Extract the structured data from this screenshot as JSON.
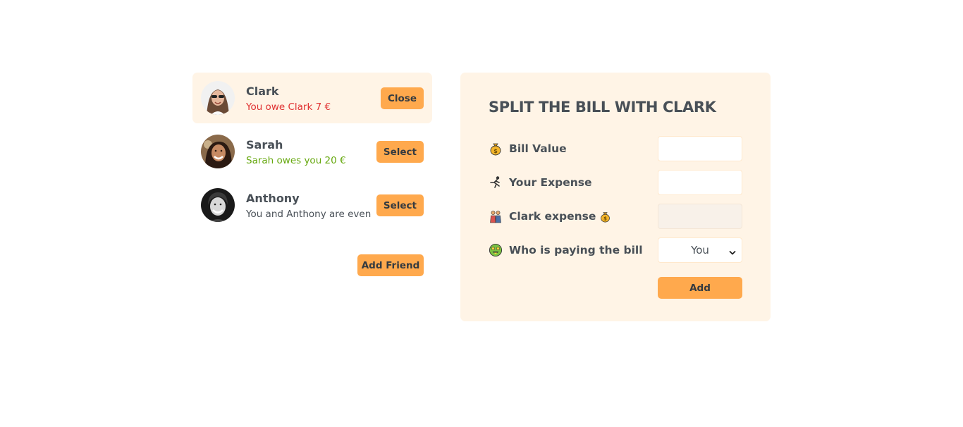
{
  "friends": [
    {
      "name": "Clark",
      "status": "You owe Clark 7 €",
      "status_tone": "red",
      "button": "Close",
      "selected": true
    },
    {
      "name": "Sarah",
      "status": "Sarah owes you 20 €",
      "status_tone": "green",
      "button": "Select",
      "selected": false
    },
    {
      "name": "Anthony",
      "status": "You and Anthony are even",
      "status_tone": "neutral",
      "button": "Select",
      "selected": false
    }
  ],
  "add_friend_label": "Add Friend",
  "split": {
    "title": "Split the bill with Clark",
    "bill_value_label": "Bill Value",
    "your_expense_label": "Your Expense",
    "friend_expense_label": "Clark expense",
    "payer_label": "Who is paying the bill",
    "bill_value": "",
    "your_expense": "",
    "friend_expense": "",
    "payer_selected": "You",
    "add_label": "Add"
  },
  "icons": {
    "bill_value": "money-bag-icon",
    "your_expense": "person-running-icon",
    "friend_expense": "couple-icon",
    "friend_expense_suffix": "money-bag-icon",
    "payer": "money-mouth-face-icon"
  },
  "colors": {
    "accent": "#ffa94d",
    "panel_bg": "#fff4e6",
    "text": "#495057",
    "owe_red": "#e03131",
    "owed_green": "#66a80f"
  }
}
